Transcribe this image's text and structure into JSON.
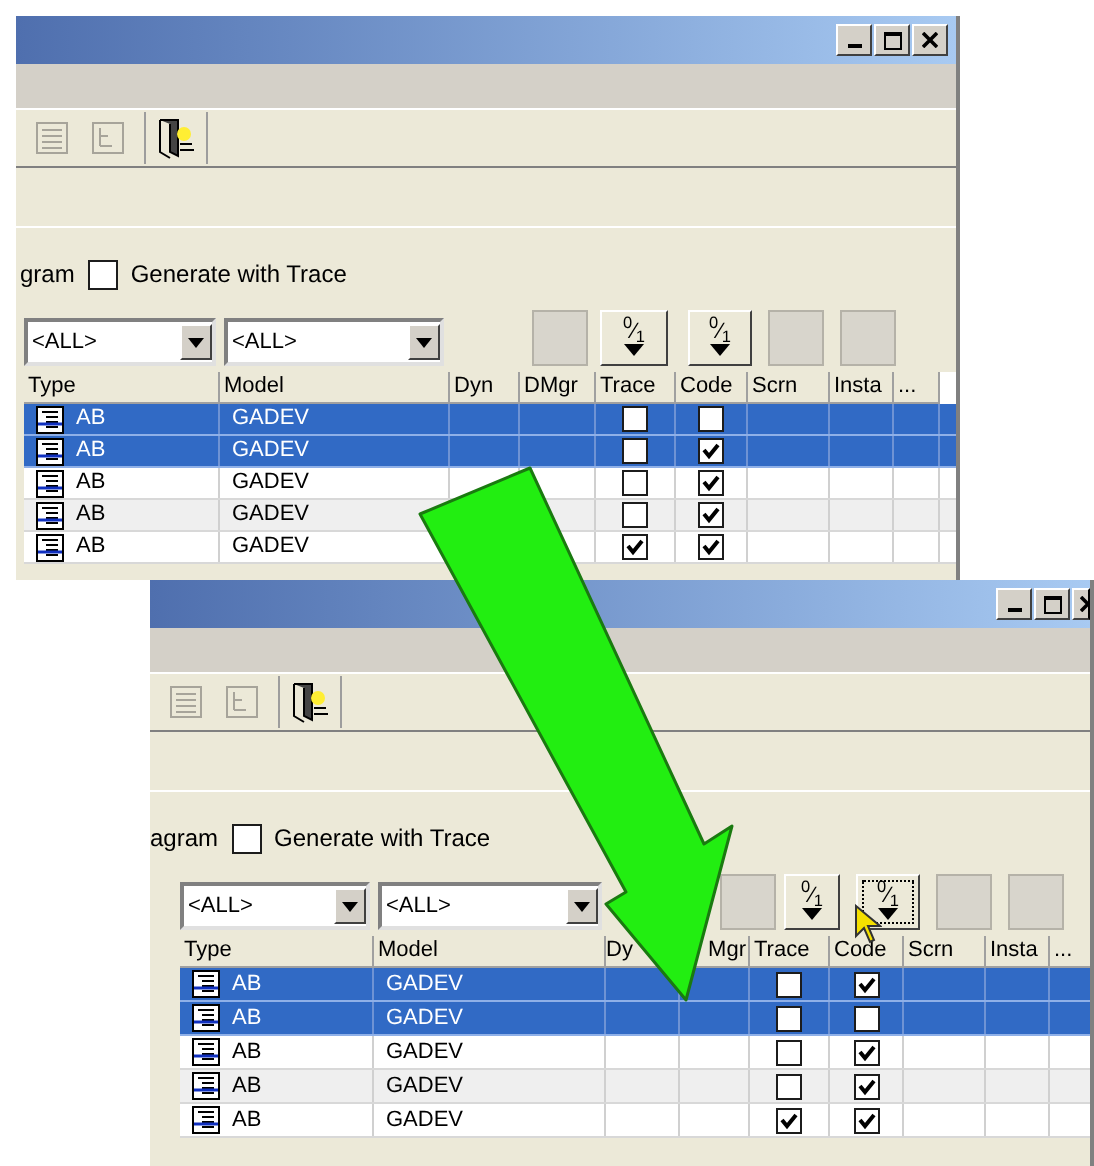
{
  "windows": [
    {
      "toolbar": [
        {
          "kind": "list",
          "disabled": true
        },
        {
          "kind": "tree",
          "disabled": true
        },
        {
          "kind": "exit",
          "disabled": false
        }
      ],
      "option_fragment": "gram",
      "trace_option": {
        "label": "Generate with Trace",
        "checked": false
      },
      "filters": [
        {
          "value": "<ALL>"
        },
        {
          "value": "<ALL>"
        }
      ],
      "filter_buttons": [
        {
          "kind": "blank",
          "focused": false
        },
        {
          "kind": "sort",
          "label": "$^{0}$⁄$_{1}$",
          "focused": false
        },
        {
          "kind": "sort",
          "label": "$^{0}$⁄$_{1}$",
          "focused": false
        },
        {
          "kind": "blank",
          "focused": false
        },
        {
          "kind": "blank",
          "focused": false
        }
      ],
      "columns": [
        "Type",
        "Model",
        "Dyn",
        "DMgr",
        "Trace",
        "Code",
        "Scrn",
        "Insta",
        "..."
      ],
      "rows": [
        {
          "type": "AB",
          "model": "GADEV",
          "trace": false,
          "code": false,
          "selected": true
        },
        {
          "type": "AB",
          "model": "GADEV",
          "trace": false,
          "code": true,
          "selected": true
        },
        {
          "type": "AB",
          "model": "GADEV",
          "trace": false,
          "code": true,
          "selected": false
        },
        {
          "type": "AB",
          "model": "GADEV",
          "trace": false,
          "code": true,
          "selected": false
        },
        {
          "type": "AB",
          "model": "GADEV",
          "trace": true,
          "code": true,
          "selected": false
        }
      ]
    },
    {
      "toolbar": [
        {
          "kind": "list",
          "disabled": true
        },
        {
          "kind": "tree",
          "disabled": true
        },
        {
          "kind": "exit",
          "disabled": false
        }
      ],
      "option_fragment": "agram",
      "trace_option": {
        "label": "Generate with Trace",
        "checked": false
      },
      "filters": [
        {
          "value": "<ALL>"
        },
        {
          "value": "<ALL>"
        }
      ],
      "filter_buttons": [
        {
          "kind": "blank",
          "focused": false
        },
        {
          "kind": "sort",
          "label": "$^{0}$⁄$_{1}$",
          "focused": false
        },
        {
          "kind": "sort",
          "label": "$^{0}$⁄$_{1}$",
          "focused": true
        },
        {
          "kind": "blank",
          "focused": false
        },
        {
          "kind": "blank",
          "focused": false
        }
      ],
      "columns": [
        "Type",
        "Model",
        "Dy",
        "Mgr",
        "Trace",
        "Code",
        "Scrn",
        "Insta",
        "..."
      ],
      "rows": [
        {
          "type": "AB",
          "model": "GADEV",
          "trace": false,
          "code": true,
          "selected": true
        },
        {
          "type": "AB",
          "model": "GADEV",
          "trace": false,
          "code": false,
          "selected": true
        },
        {
          "type": "AB",
          "model": "GADEV",
          "trace": false,
          "code": true,
          "selected": false
        },
        {
          "type": "AB",
          "model": "GADEV",
          "trace": false,
          "code": true,
          "selected": false
        },
        {
          "type": "AB",
          "model": "GADEV",
          "trace": true,
          "code": true,
          "selected": false
        }
      ]
    }
  ]
}
